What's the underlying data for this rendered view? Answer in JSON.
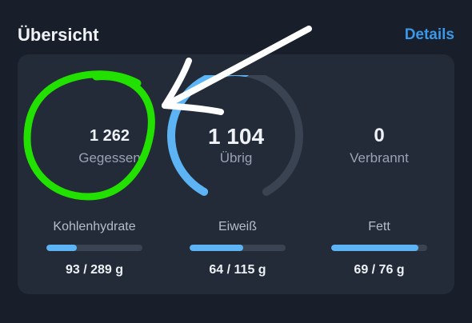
{
  "header": {
    "title": "Übersicht",
    "details_label": "Details"
  },
  "summary": {
    "eaten_value": "1 262",
    "eaten_label": "Gegessen",
    "remaining_value": "1 104",
    "remaining_label": "Übrig",
    "burned_value": "0",
    "burned_label": "Verbrannt",
    "ring_progress": 0.53
  },
  "macros": {
    "carbs": {
      "label": "Kohlenhydrate",
      "value": "93 / 289 g",
      "progress": 0.32
    },
    "protein": {
      "label": "Eiweiß",
      "value": "64 / 115 g",
      "progress": 0.56
    },
    "fat": {
      "label": "Fett",
      "value": "69 / 76 g",
      "progress": 0.91
    }
  },
  "colors": {
    "background": "#181f2a",
    "card": "#232b38",
    "accent_blue": "#5cb4f5",
    "link_blue": "#3b98e8",
    "track": "#3a4352",
    "highlight_circle": "#22e000",
    "annotation_arrow": "#ffffff"
  },
  "annotations": {
    "circle_icon": "green-hand-drawn-circle",
    "arrow_icon": "white-hand-drawn-arrow"
  }
}
